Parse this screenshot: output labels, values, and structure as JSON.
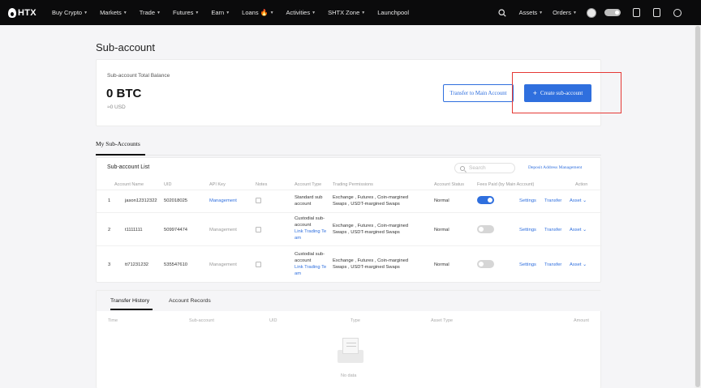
{
  "brand": {
    "logo_text": "HTX"
  },
  "nav": {
    "items": [
      "Buy Crypto",
      "Markets",
      "Trade",
      "Futures",
      "Earn",
      "Loans",
      "Activities",
      "SHTX Zone",
      "Launchpool"
    ],
    "right": {
      "assets": "Assets",
      "orders": "Orders"
    }
  },
  "page": {
    "title": "Sub-account"
  },
  "balance": {
    "label": "Sub-account Total Balance",
    "value": "0 BTC",
    "usd": "≈0 USD",
    "transfer_button": "Transfer to Main Account",
    "create_button": "Create sub-account"
  },
  "tabs": {
    "my_sub_accounts": "My Sub-Accounts"
  },
  "list": {
    "title": "Sub-account List",
    "search_placeholder": "Search",
    "deposit_link": "Deposit Address Management",
    "headers": [
      "Account Name",
      "UID",
      "API Key",
      "Notes",
      "Account Type",
      "Trading Permissions",
      "Account Status",
      "Fees Paid (by Main Account)",
      "Action"
    ],
    "rows": [
      {
        "index": "1",
        "name": "jason12312322",
        "uid": "502018025",
        "api_key": "Management",
        "type_line1": "Standard sub",
        "type_line2": "account",
        "type_line3": "",
        "type_line4": "",
        "perm_line1": "Exchange , Futures , Coin-margined",
        "perm_line2": "Swaps , USDT-margined Swaps",
        "status": "Normal",
        "fees_on": true,
        "settings": "Settings",
        "transfer": "Transfer",
        "asset": "Asset"
      },
      {
        "index": "2",
        "name": "t1111111",
        "uid": "509974474",
        "api_key": "Management",
        "type_line1": "Custodial sub-",
        "type_line2": "account",
        "type_line3": "Link Trading Te",
        "type_line4": "am",
        "perm_line1": "Exchange , Futures , Coin-margined",
        "perm_line2": "Swaps , USDT-margined Swaps",
        "status": "Normal",
        "fees_on": false,
        "settings": "Settings",
        "transfer": "Transfer",
        "asset": "Asset"
      },
      {
        "index": "3",
        "name": "tt71231232",
        "uid": "535547610",
        "api_key": "Management",
        "type_line1": "Custodial sub-",
        "type_line2": "account",
        "type_line3": "Link Trading Te",
        "type_line4": "am",
        "perm_line1": "Exchange , Futures , Coin-margined",
        "perm_line2": "Swaps , USDT-margined Swaps",
        "status": "Normal",
        "fees_on": false,
        "settings": "Settings",
        "transfer": "Transfer",
        "asset": "Asset"
      }
    ]
  },
  "history": {
    "tab_transfer": "Transfer History",
    "tab_records": "Account Records",
    "headers": [
      "Time",
      "Sub-account",
      "UID",
      "Type",
      "Asset Type",
      "Amount"
    ],
    "empty": "No data"
  },
  "colors": {
    "accent": "#2f6fde",
    "highlight": "#e53935",
    "topbar": "#0b0b0c"
  }
}
